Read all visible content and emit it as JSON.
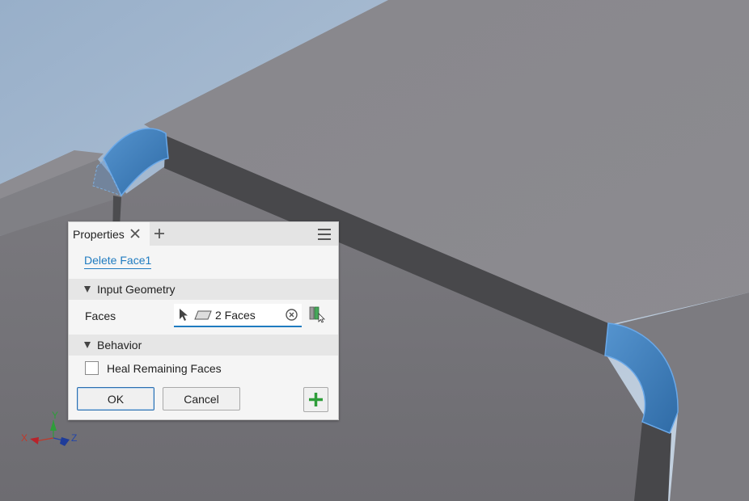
{
  "viewport": {
    "colors": {
      "sky": "#b3c4d9",
      "body": "#858489",
      "edge": "#48484b",
      "selected": "#3d7fbd"
    }
  },
  "panel": {
    "tab_label": "Properties",
    "feature_name": "Delete Face1",
    "sections": {
      "input_geometry": "Input Geometry",
      "behavior": "Behavior"
    },
    "faces": {
      "label": "Faces",
      "value": "2 Faces"
    },
    "heal": {
      "label": "Heal Remaining Faces",
      "checked": false
    },
    "buttons": {
      "ok": "OK",
      "cancel": "Cancel"
    },
    "icons": {
      "close": "close-icon",
      "add_tab": "plus-icon",
      "menu": "hamburger-menu-icon",
      "select_cursor": "arrow-cursor-icon",
      "face_filter": "face-parallelogram-icon",
      "clear": "clear-circle-icon",
      "select_other": "select-other-icon",
      "apply": "green-plus-icon"
    },
    "colors": {
      "accent": "#1f7bc0",
      "apply_green": "#2e9d3a"
    }
  },
  "triad": {
    "x_label": "X",
    "y_label": "Y",
    "z_label": "Z"
  }
}
